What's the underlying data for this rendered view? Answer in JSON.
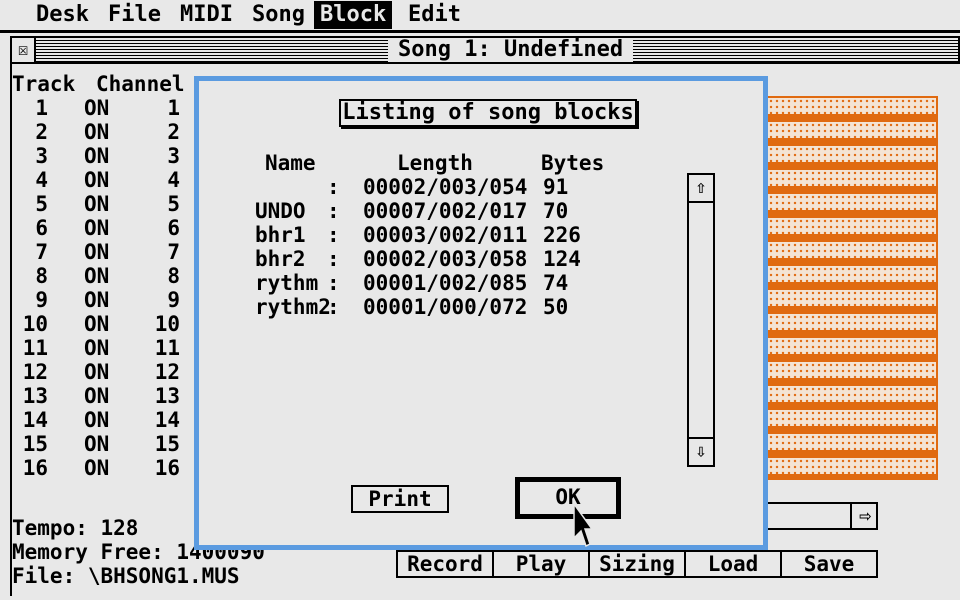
{
  "menubar": {
    "items": [
      {
        "label": "Desk"
      },
      {
        "label": "File"
      },
      {
        "label": "MIDI"
      },
      {
        "label": "Song"
      },
      {
        "label": "Block",
        "active": true
      },
      {
        "label": "Edit"
      }
    ]
  },
  "window": {
    "close_glyph": "☒",
    "title": "Song 1: Undefined"
  },
  "tracks": {
    "header_track": "Track",
    "header_channel": "Channel",
    "rows": [
      {
        "track": "1",
        "state": "ON",
        "channel": "1"
      },
      {
        "track": "2",
        "state": "ON",
        "channel": "2"
      },
      {
        "track": "3",
        "state": "ON",
        "channel": "3"
      },
      {
        "track": "4",
        "state": "ON",
        "channel": "4"
      },
      {
        "track": "5",
        "state": "ON",
        "channel": "5"
      },
      {
        "track": "6",
        "state": "ON",
        "channel": "6"
      },
      {
        "track": "7",
        "state": "ON",
        "channel": "7"
      },
      {
        "track": "8",
        "state": "ON",
        "channel": "8"
      },
      {
        "track": "9",
        "state": "ON",
        "channel": "9"
      },
      {
        "track": "10",
        "state": "ON",
        "channel": "10"
      },
      {
        "track": "11",
        "state": "ON",
        "channel": "11"
      },
      {
        "track": "12",
        "state": "ON",
        "channel": "12"
      },
      {
        "track": "13",
        "state": "ON",
        "channel": "13"
      },
      {
        "track": "14",
        "state": "ON",
        "channel": "14"
      },
      {
        "track": "15",
        "state": "ON",
        "channel": "15"
      },
      {
        "track": "16",
        "state": "ON",
        "channel": "16"
      }
    ]
  },
  "status": {
    "tempo": "Tempo: 128",
    "memory": "Memory Free: 1400090",
    "file": "File: \\BHSONG1.MUS"
  },
  "buttons": {
    "record": "Record",
    "play": "Play",
    "sizing": "Sizing",
    "load": "Load",
    "save": "Save"
  },
  "dialog": {
    "title": "Listing of song blocks",
    "col_name": "Name",
    "col_length": "Length",
    "col_bytes": "Bytes",
    "rows": [
      {
        "name": "",
        "colon": ":",
        "length": "00002/003/054",
        "bytes": "91"
      },
      {
        "name": "UNDO",
        "colon": ":",
        "length": "00007/002/017",
        "bytes": "70"
      },
      {
        "name": "bhr1",
        "colon": ":",
        "length": "00003/002/011",
        "bytes": "226"
      },
      {
        "name": "bhr2",
        "colon": ":",
        "length": "00002/003/058",
        "bytes": "124"
      },
      {
        "name": "rythm",
        "colon": ":",
        "length": "00001/002/085",
        "bytes": "74"
      },
      {
        "name": "rythm2",
        "colon": ":",
        "length": "00001/000/072",
        "bytes": "50"
      }
    ],
    "scroll_up": "⇧",
    "scroll_down": "⇩",
    "print": "Print",
    "ok": "OK"
  },
  "slider": {
    "arrow": "⇨"
  },
  "colors": {
    "dialog_border": "#5b9be0",
    "grid_orange": "#e06a10",
    "background": "#e8e8e8"
  },
  "icons": {
    "close": "close-box-icon",
    "scroll_up": "arrow-up-icon",
    "scroll_down": "arrow-down-icon",
    "slider": "arrow-right-icon",
    "cursor": "mouse-pointer-icon"
  }
}
